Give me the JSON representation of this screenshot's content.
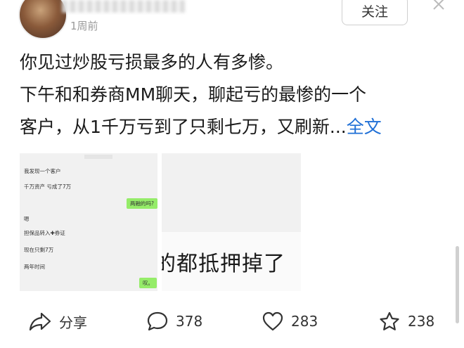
{
  "header": {
    "time": "1周前",
    "follow_label": "关注"
  },
  "post": {
    "line1": "你见过炒股亏损最多的人有多惨。",
    "line2": "下午和和券商MM聊天，聊起亏的最惨的一个",
    "line3_text": "客户，从1千万亏到了只剩七万，又刷新...",
    "more_label": "全文"
  },
  "images": [
    {
      "chat": {
        "msg1": "我发现一个客户",
        "msg2": "千万资产 亏成了7万",
        "reply1": "两融的吗?",
        "msg3": "嗯",
        "msg4": "担保品转入✚券证",
        "msg5": "现在只剩7万",
        "msg6": "两年时间",
        "reply2": "叹。"
      }
    },
    {
      "caption": "的都抵押掉了"
    }
  ],
  "actions": {
    "share_label": "分享",
    "comment_count": "378",
    "like_count": "283",
    "favorite_count": "238"
  },
  "icons": {
    "share": "share-icon",
    "comment": "comment-icon",
    "like": "heart-icon",
    "favorite": "star-icon",
    "close": "close-icon"
  }
}
